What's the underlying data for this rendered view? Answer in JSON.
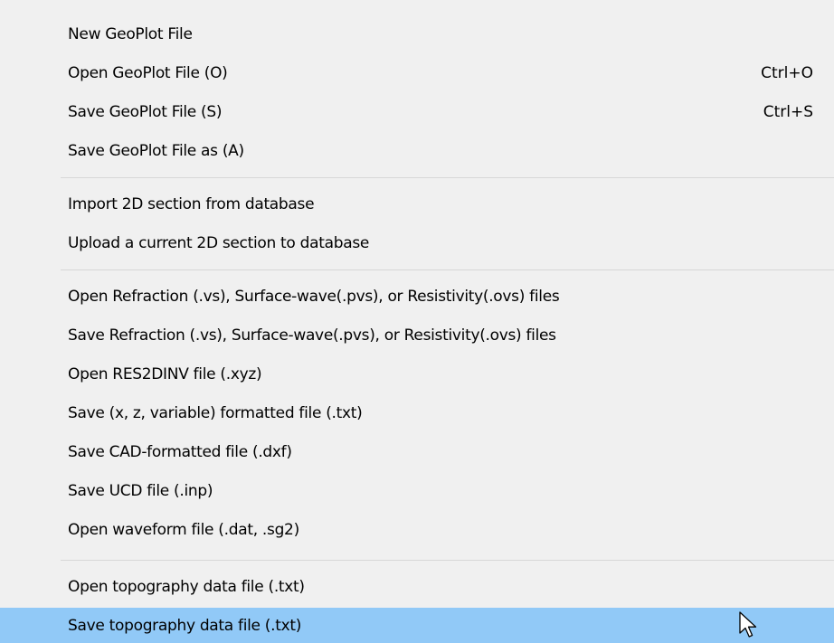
{
  "menu": {
    "items": [
      {
        "label": "New GeoPlot File",
        "shortcut": ""
      },
      {
        "label": "Open GeoPlot File (O)",
        "shortcut": "Ctrl+O"
      },
      {
        "label": "Save GeoPlot File (S)",
        "shortcut": "Ctrl+S"
      },
      {
        "label": "Save GeoPlot File as (A)",
        "shortcut": ""
      },
      {
        "label": "Import 2D section from database",
        "shortcut": ""
      },
      {
        "label": "Upload a current 2D section to database",
        "shortcut": ""
      },
      {
        "label": "Open Refraction (.vs), Surface-wave(.pvs), or Resistivity(.ovs) files",
        "shortcut": ""
      },
      {
        "label": "Save Refraction (.vs), Surface-wave(.pvs), or Resistivity(.ovs) files",
        "shortcut": ""
      },
      {
        "label": "Open RES2DINV file (.xyz)",
        "shortcut": ""
      },
      {
        "label": "Save (x, z, variable) formatted file (.txt)",
        "shortcut": ""
      },
      {
        "label": "Save CAD-formatted file (.dxf)",
        "shortcut": ""
      },
      {
        "label": "Save UCD file (.inp)",
        "shortcut": ""
      },
      {
        "label": "Open waveform file (.dat, .sg2)",
        "shortcut": ""
      },
      {
        "label": "Open topography data file (.txt)",
        "shortcut": ""
      },
      {
        "label": "Save topography data file (.txt)",
        "shortcut": ""
      }
    ],
    "highlighted_item": "Save topography data file (.txt)",
    "highlight_color": "#91c9f7"
  },
  "cursor": {
    "icon": "mouse-pointer-icon"
  }
}
